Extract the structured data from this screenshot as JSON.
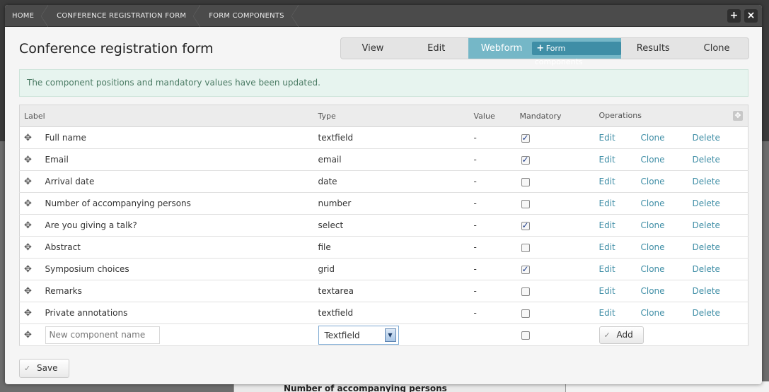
{
  "breadcrumbs": [
    "HOME",
    "CONFERENCE REGISTRATION FORM",
    "FORM COMPONENTS"
  ],
  "window_controls": {
    "plus": "+",
    "close": "×"
  },
  "page_title": "Conference registration form",
  "tabs": {
    "view": "View",
    "edit": "Edit",
    "webform": "Webform",
    "form_components": "Form components",
    "results": "Results",
    "clone": "Clone"
  },
  "message": "The component positions and mandatory values have been updated.",
  "table": {
    "headers": {
      "label": "Label",
      "type": "Type",
      "value": "Value",
      "mandatory": "Mandatory",
      "operations": "Operations"
    },
    "rows": [
      {
        "label": "Full name",
        "type": "textfield",
        "value": "-",
        "mandatory": true
      },
      {
        "label": "Email",
        "type": "email",
        "value": "-",
        "mandatory": true
      },
      {
        "label": "Arrival date",
        "type": "date",
        "value": "-",
        "mandatory": false
      },
      {
        "label": "Number of accompanying persons",
        "type": "number",
        "value": "-",
        "mandatory": false
      },
      {
        "label": "Are you giving a talk?",
        "type": "select",
        "value": "-",
        "mandatory": true
      },
      {
        "label": "Abstract",
        "type": "file",
        "value": "-",
        "mandatory": false
      },
      {
        "label": "Symposium choices",
        "type": "grid",
        "value": "-",
        "mandatory": true
      },
      {
        "label": "Remarks",
        "type": "textarea",
        "value": "-",
        "mandatory": false
      },
      {
        "label": "Private annotations",
        "type": "textfield",
        "value": "-",
        "mandatory": false
      }
    ],
    "operations": {
      "edit": "Edit",
      "clone": "Clone",
      "delete": "Delete"
    },
    "new_component": {
      "placeholder": "New component name",
      "type_selected": "Textfield",
      "mandatory": false,
      "add_label": "Add"
    }
  },
  "save_label": "Save",
  "background_text": "Number of accompanying persons",
  "colors": {
    "accent": "#75b7c7",
    "link": "#3f8ea6",
    "message_bg": "#e7f4ef"
  }
}
